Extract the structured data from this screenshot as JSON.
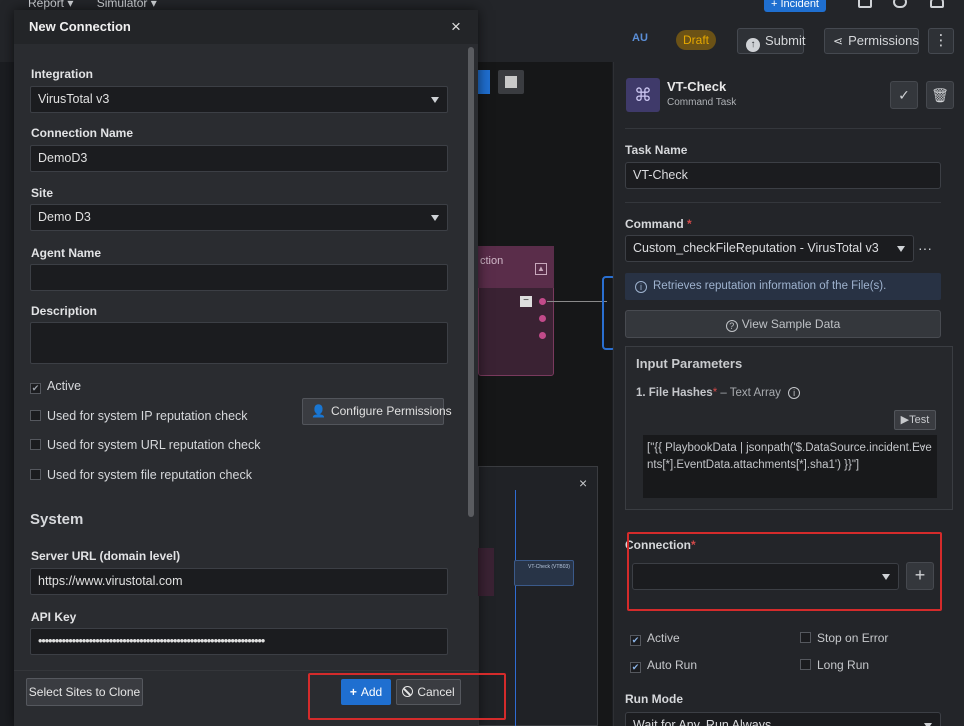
{
  "top_menu": {
    "items": [
      "Report ▾",
      "Simulator ▾"
    ],
    "incident_button": "+ Incident"
  },
  "toolbar": {
    "au_label": "AU",
    "draft_badge": "Draft",
    "submit_label": "Submit",
    "permissions_label": "Permissions",
    "more_label": "⋮"
  },
  "canvas": {
    "node_label": "ction"
  },
  "task": {
    "title": "VT-Check",
    "subtitle": "Command Task",
    "task_name_label": "Task Name",
    "task_name_value": "VT-Check",
    "command_label": "Command",
    "required_mark": "*",
    "command_value": "Custom_checkFileReputation - VirusTotal v3",
    "command_dots": "···",
    "info_text": "Retrieves reputation information of the File(s).",
    "sample_button": "View Sample Data",
    "input_params_title": "Input Parameters",
    "file_hash_label": "1. File Hashes",
    "file_hash_type": "– Text Array",
    "test_button": "Test",
    "code_value": "[\"{{ PlaybookData | jsonpath('$.DataSource.incident.Events[*].EventData.attachments[*].sha1') }}\"]",
    "code_dots": "···",
    "connection_label": "Connection",
    "connection_add": "+",
    "active_label": "Active",
    "auto_run_label": "Auto Run",
    "stop_on_error_label": "Stop on Error",
    "long_run_label": "Long Run",
    "run_mode_label": "Run Mode",
    "run_mode_value": "Wait for Any, Run Always"
  },
  "dialog": {
    "title": "New Connection",
    "close": "×",
    "integration_label": "Integration",
    "integration_value": "VirusTotal v3",
    "connection_name_label": "Connection Name",
    "connection_name_value": "DemoD3",
    "site_label": "Site",
    "site_value": "Demo D3",
    "agent_name_label": "Agent Name",
    "agent_name_value": "",
    "description_label": "Description",
    "description_value": "",
    "active_label": "Active",
    "ip_check_label": "Used for system IP reputation check",
    "url_check_label": "Used for system URL reputation check",
    "file_check_label": "Used for system file reputation check",
    "configure_permissions": "Configure Permissions",
    "system_heading": "System",
    "server_url_label": "Server URL (domain level)",
    "server_url_value": "https://www.virustotal.com",
    "api_key_label": "API Key",
    "api_key_value": "•••••••••••••••••••••••••••••••••••••••••••••••••••••••••••••••••••",
    "clone_button": "Select Sites to Clone",
    "add_button": "Add",
    "cancel_button": "Cancel"
  },
  "mini_panel": {
    "close": "×",
    "node_label": "VT-Check (VTB03)"
  }
}
